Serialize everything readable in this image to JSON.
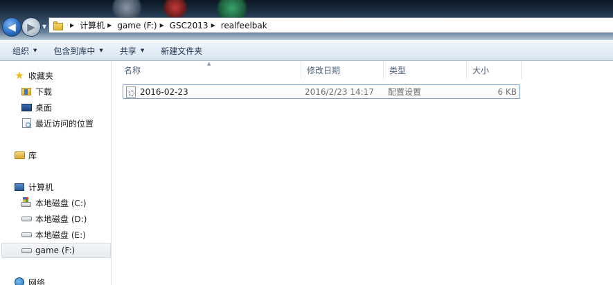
{
  "address": {
    "breadcrumbs": [
      "计算机",
      "game (F:)",
      "GSC2013",
      "realfeelbak"
    ]
  },
  "toolbar": {
    "organize": "组织",
    "include_in_library": "包含到库中",
    "share": "共享",
    "new_folder": "新建文件夹"
  },
  "nav": {
    "favorites": "收藏夹",
    "downloads": "下载",
    "desktop": "桌面",
    "recent": "最近访问的位置",
    "libraries": "库",
    "computer": "计算机",
    "drive_c": "本地磁盘 (C:)",
    "drive_d": "本地磁盘 (D:)",
    "drive_e": "本地磁盘 (E:)",
    "drive_f": "game (F:)",
    "network": "网络"
  },
  "columns": {
    "name": "名称",
    "date": "修改日期",
    "type": "类型",
    "size": "大小"
  },
  "files": [
    {
      "name": "2016-02-23",
      "date": "2016/2/23 14:17",
      "type": "配置设置",
      "size": "6 KB",
      "icon": "config-file-icon"
    }
  ]
}
